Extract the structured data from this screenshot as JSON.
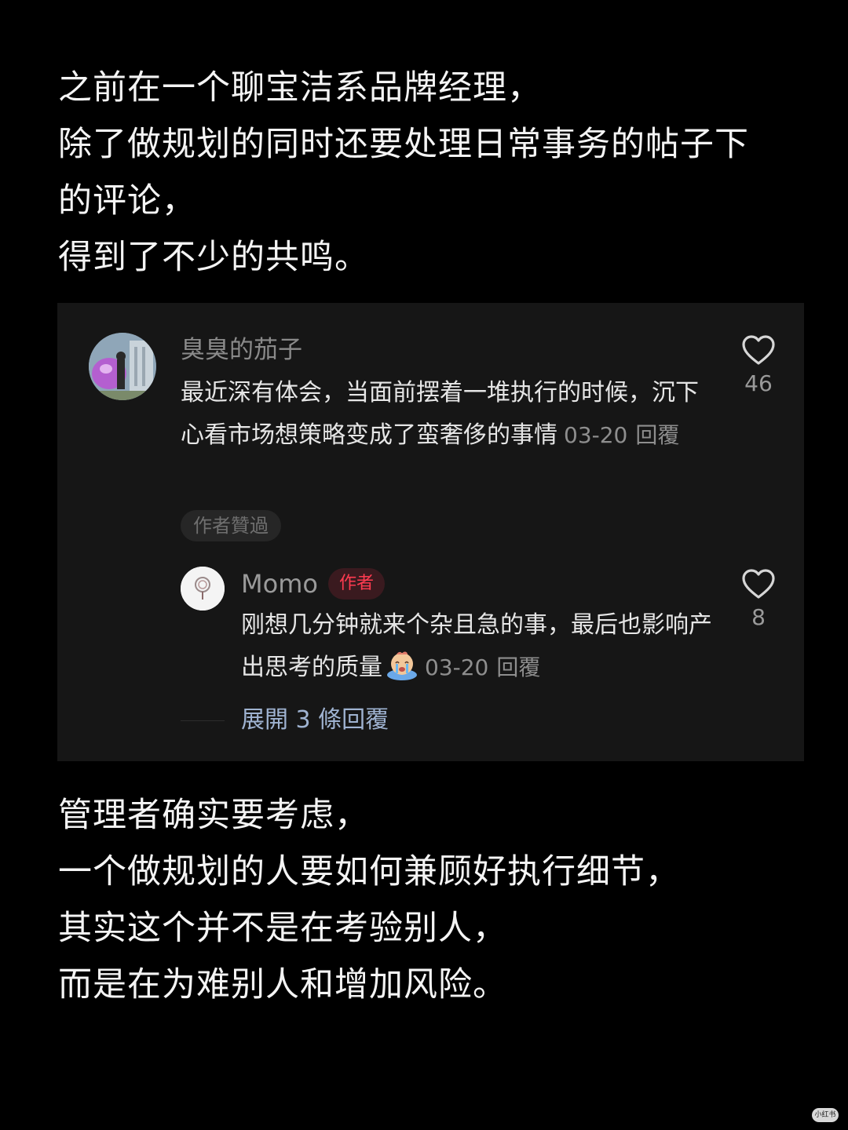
{
  "intro": {
    "lines": [
      "之前在一个聊宝洁系品牌经理，",
      "除了做规划的同时还要处理日常事务的帖子下",
      "的评论，",
      "得到了不少的共鸣。"
    ]
  },
  "comment": {
    "username": "臭臭的茄子",
    "text": "最近深有体会，当面前摆着一堆执行的时候，沉下心看市场想策略变成了蛮奢侈的事情",
    "date": "03-20",
    "reply_label": "回覆",
    "likes": "46",
    "author_liked": "作者贊過",
    "avatar_icon": "avatar-photo"
  },
  "reply": {
    "username": "Momo",
    "badge": "作者",
    "text": "刚想几分钟就来个杂且急的事，最后也影响产出思考的质量",
    "emoji": "crying-face-emoji",
    "date": "03-20",
    "reply_label": "回覆",
    "likes": "8",
    "expand_label": "展開 3 條回覆"
  },
  "outro": {
    "lines": [
      "管理者确实要考虑，",
      "一个做规划的人要如何兼顾好执行细节，",
      "其实这个并不是在考验别人，",
      "而是在为难别人和增加风险。"
    ]
  },
  "watermark": "小红书",
  "colors": {
    "background": "#000000",
    "card": "#161616",
    "badge_text": "#ff3b50",
    "expand_text": "#9fb3d1"
  }
}
